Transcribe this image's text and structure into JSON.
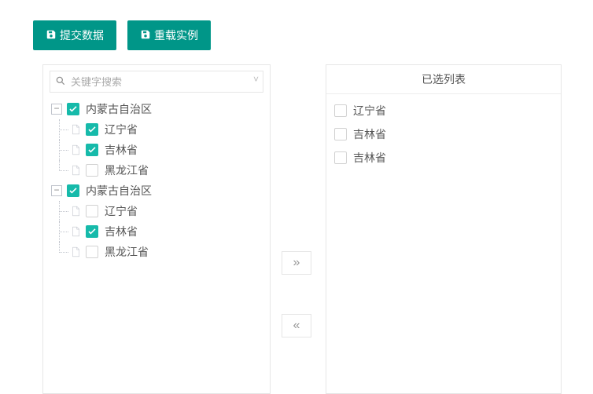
{
  "toolbar": {
    "submit_label": "提交数据",
    "reload_label": "重载实例"
  },
  "search": {
    "placeholder": "关键字搜索"
  },
  "right_panel": {
    "header": "已选列表"
  },
  "tree": {
    "groups": [
      {
        "label": "内蒙古自治区",
        "expanded": true,
        "checked": true,
        "children": [
          {
            "label": "辽宁省",
            "checked": true
          },
          {
            "label": "吉林省",
            "checked": true
          },
          {
            "label": "黑龙江省",
            "checked": false
          }
        ]
      },
      {
        "label": "内蒙古自治区",
        "expanded": true,
        "checked": true,
        "children": [
          {
            "label": "辽宁省",
            "checked": false
          },
          {
            "label": "吉林省",
            "checked": true
          },
          {
            "label": "黑龙江省",
            "checked": false
          }
        ]
      }
    ]
  },
  "selected": {
    "items": [
      {
        "label": "辽宁省"
      },
      {
        "label": "吉林省"
      },
      {
        "label": "吉林省"
      }
    ]
  },
  "transfer": {
    "to_right_glyph": "»",
    "to_left_glyph": "«"
  }
}
